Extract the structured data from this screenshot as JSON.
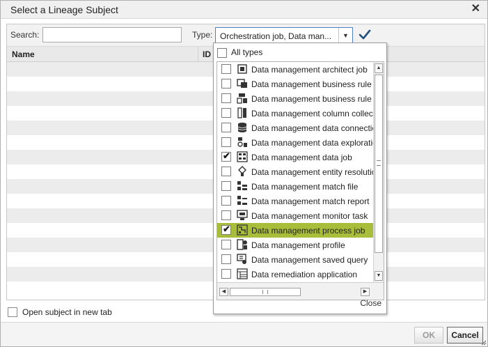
{
  "dialog": {
    "title": "Select a Lineage Subject",
    "close_icon": "close-x-icon"
  },
  "toolbar": {
    "search_label": "Search:",
    "search_value": "",
    "type_label": "Type:",
    "type_value": "Orchestration job, Data man...",
    "apply_icon": "checkmark-icon"
  },
  "grid": {
    "columns": [
      "Name",
      "ID"
    ],
    "row_count": 16
  },
  "dropdown": {
    "all_types_label": "All types",
    "all_types_checked": false,
    "items": [
      {
        "label": "Data management architect job",
        "checked": false,
        "icon": "architect-job-icon"
      },
      {
        "label": "Data management business rule",
        "checked": false,
        "icon": "business-rule-icon"
      },
      {
        "label": "Data management business rule set",
        "checked": false,
        "icon": "business-rule-set-icon"
      },
      {
        "label": "Data management column collection",
        "checked": false,
        "icon": "column-collection-icon"
      },
      {
        "label": "Data management data connection",
        "checked": false,
        "icon": "database-icon"
      },
      {
        "label": "Data management data exploration",
        "checked": false,
        "icon": "data-exploration-icon"
      },
      {
        "label": "Data management data job",
        "checked": true,
        "icon": "data-job-icon"
      },
      {
        "label": "Data management entity resolution",
        "checked": false,
        "icon": "entity-resolution-icon"
      },
      {
        "label": "Data management match file",
        "checked": false,
        "icon": "match-file-icon"
      },
      {
        "label": "Data management match report",
        "checked": false,
        "icon": "match-report-icon"
      },
      {
        "label": "Data management monitor task",
        "checked": false,
        "icon": "monitor-task-icon"
      },
      {
        "label": "Data management process job",
        "checked": true,
        "selected": true,
        "icon": "process-job-icon"
      },
      {
        "label": "Data management profile",
        "checked": false,
        "icon": "profile-icon"
      },
      {
        "label": "Data management saved query",
        "checked": false,
        "icon": "saved-query-icon"
      },
      {
        "label": "Data remediation application",
        "checked": false,
        "icon": "remediation-app-icon"
      }
    ],
    "close_label": "Close"
  },
  "open_new_tab_label": "Open subject in new tab",
  "open_new_tab_checked": false,
  "footer": {
    "ok_label": "OK",
    "cancel_label": "Cancel"
  },
  "colors": {
    "selection": "#a8bd3a",
    "select_border": "#4d7fc4",
    "check": "#1f4f7a"
  }
}
